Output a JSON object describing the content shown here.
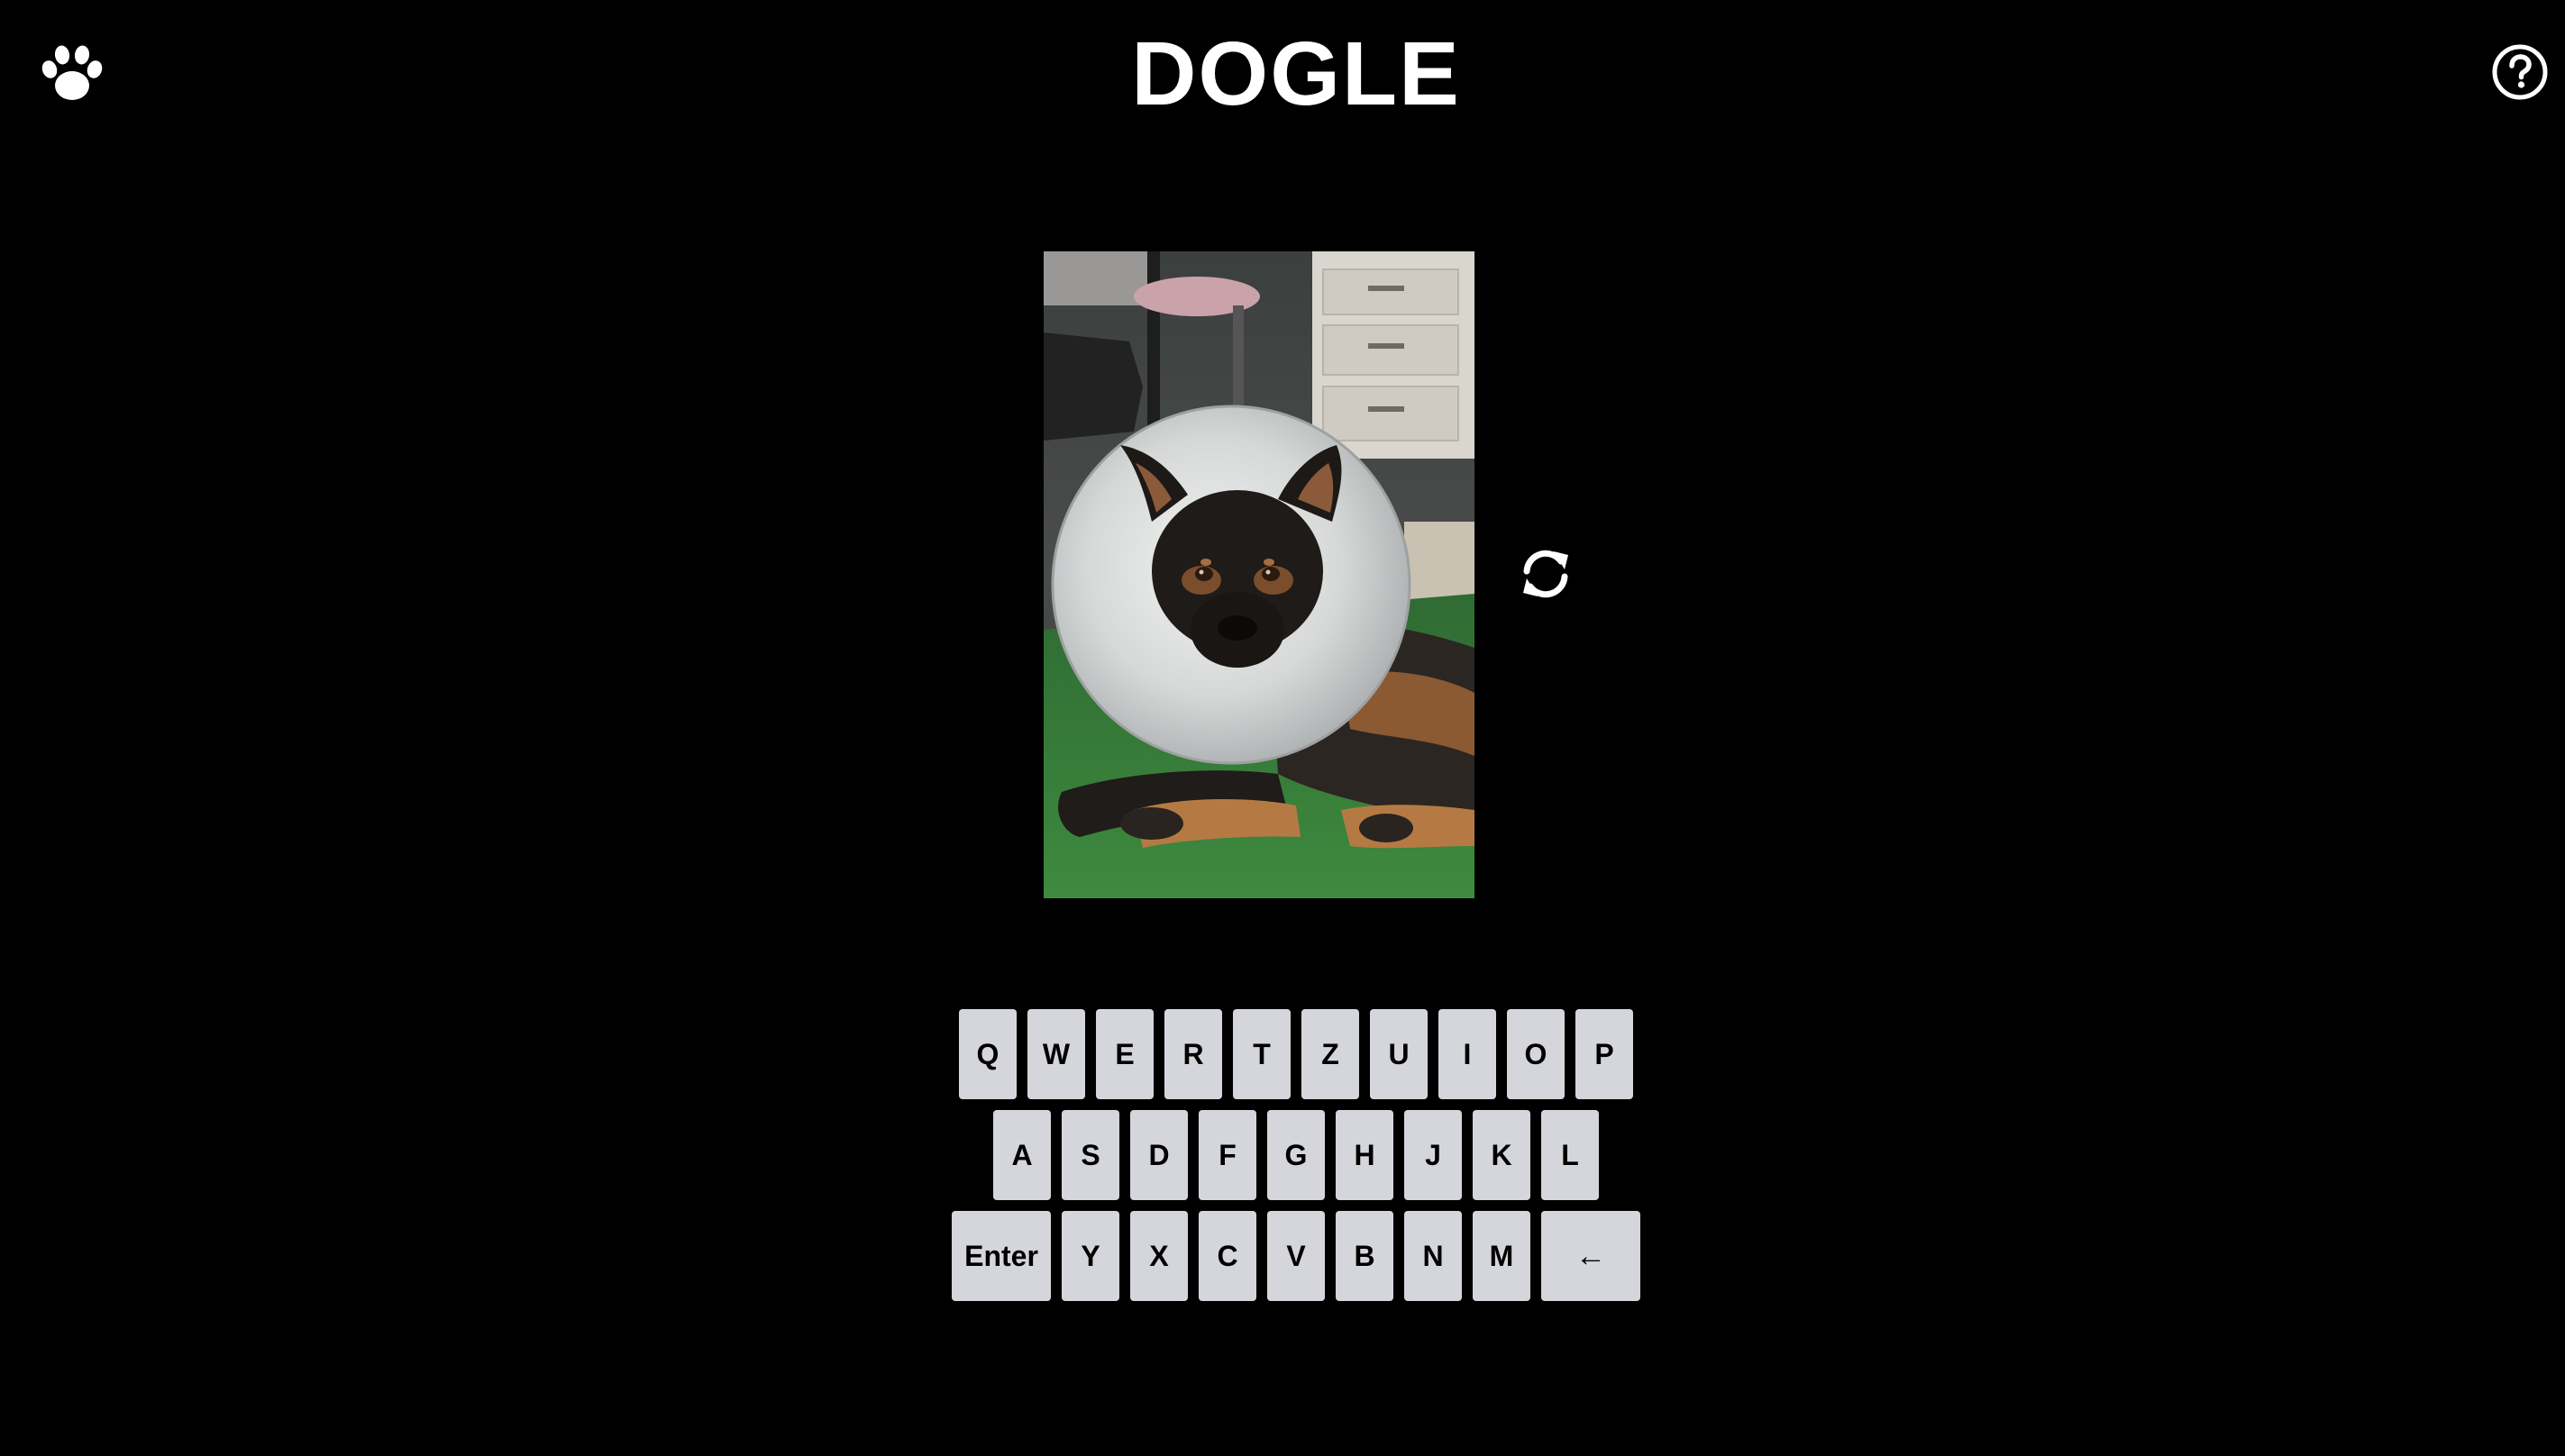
{
  "header": {
    "title": "DOGLE",
    "left_icon": "paw-icon",
    "right_icon": "help-circle-icon"
  },
  "main": {
    "photo_subject": "dog-photo",
    "refresh_icon": "refresh-icon"
  },
  "keyboard": {
    "rows": [
      [
        "Q",
        "W",
        "E",
        "R",
        "T",
        "Z",
        "U",
        "I",
        "O",
        "P"
      ],
      [
        "A",
        "S",
        "D",
        "F",
        "G",
        "H",
        "J",
        "K",
        "L"
      ],
      [
        "Enter",
        "Y",
        "X",
        "C",
        "V",
        "B",
        "N",
        "M",
        "←"
      ]
    ]
  },
  "colors": {
    "background": "#000000",
    "text": "#ffffff",
    "key_background": "#d5d6db",
    "key_text": "#000000"
  }
}
